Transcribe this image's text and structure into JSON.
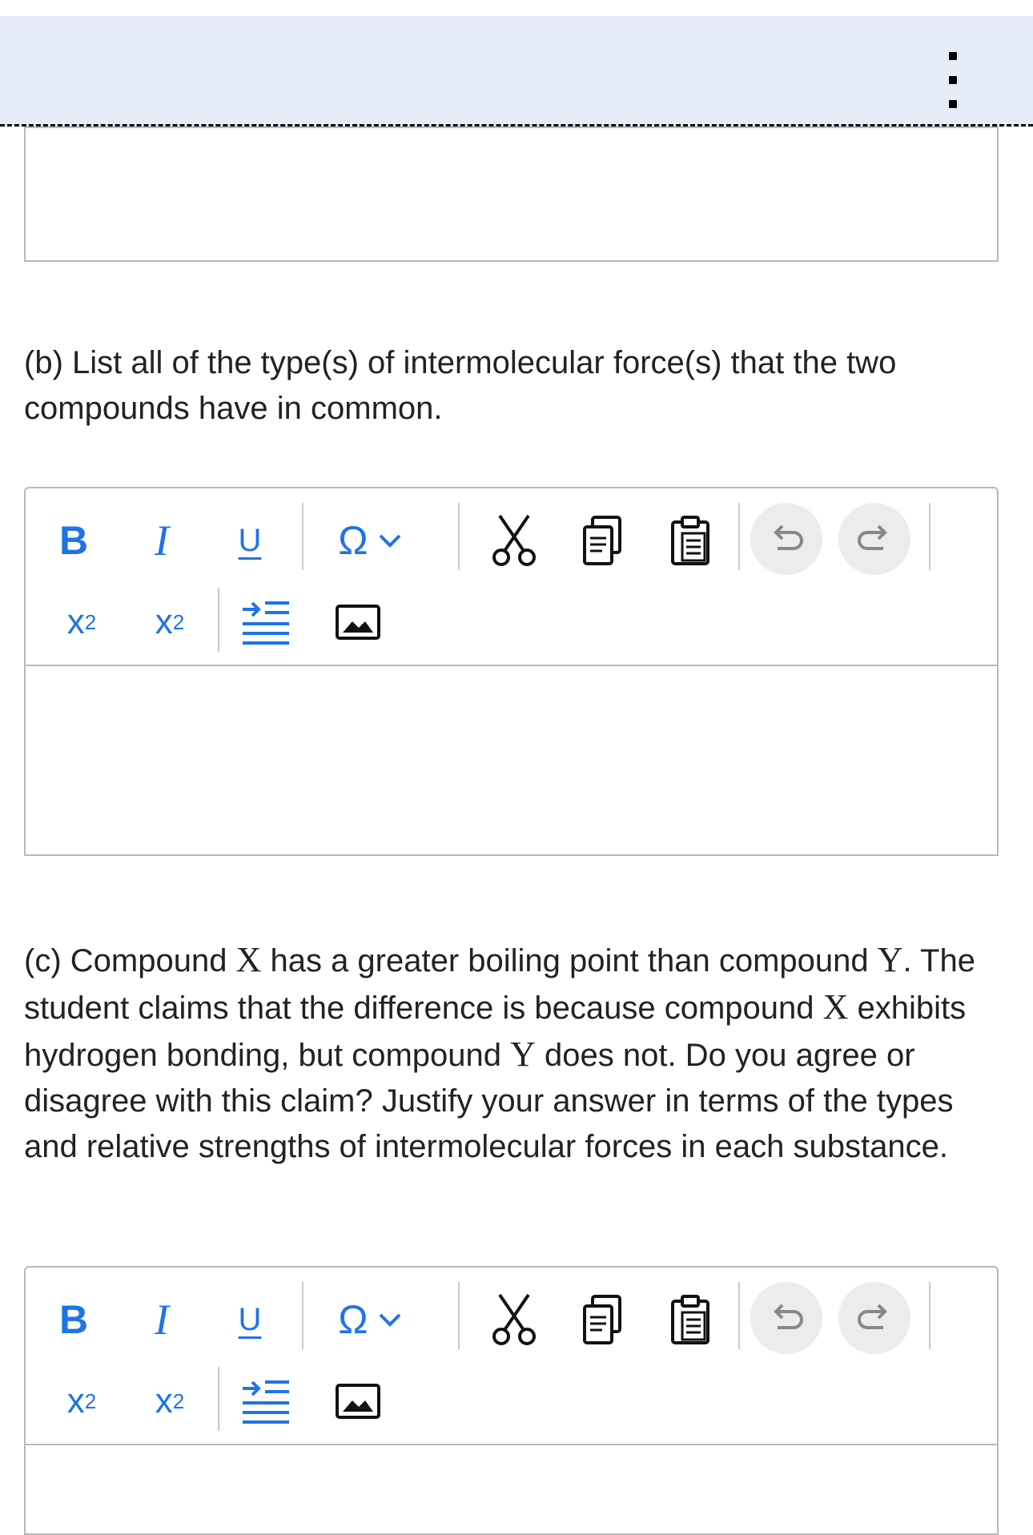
{
  "colors": {
    "topbar": "#e6ecf7",
    "accent": "#1f73e8",
    "border": "#b9b9b9"
  },
  "header": {
    "menu_icon": "vertical-ellipsis-icon"
  },
  "question_b": {
    "text": "(b) List all of the type(s) of intermolecular force(s) that the two compounds have in common."
  },
  "question_c": {
    "p1": "(c) Compound ",
    "var_x": "X",
    "p2": " has a greater boiling point than compound ",
    "var_y": "Y",
    "p3": ". The student claims that the difference is because compound ",
    "p4": " exhibits hydrogen bonding, but compound ",
    "p5": " does not. Do you agree or disagree with this claim? Justify your answer in terms of the types and relative strengths of intermolecular forces in each substance."
  },
  "toolbar": {
    "bold_label": "B",
    "italic_label": "I",
    "underline_label": "U",
    "special_char_label": "Ω",
    "superscript_label": "x",
    "superscript_mark": "2",
    "subscript_label": "x",
    "subscript_mark": "2",
    "icons": [
      "chevron-down-icon",
      "scissors-icon",
      "copy-icon",
      "paste-icon",
      "undo-icon",
      "redo-icon",
      "indent-icon",
      "image-icon"
    ]
  }
}
